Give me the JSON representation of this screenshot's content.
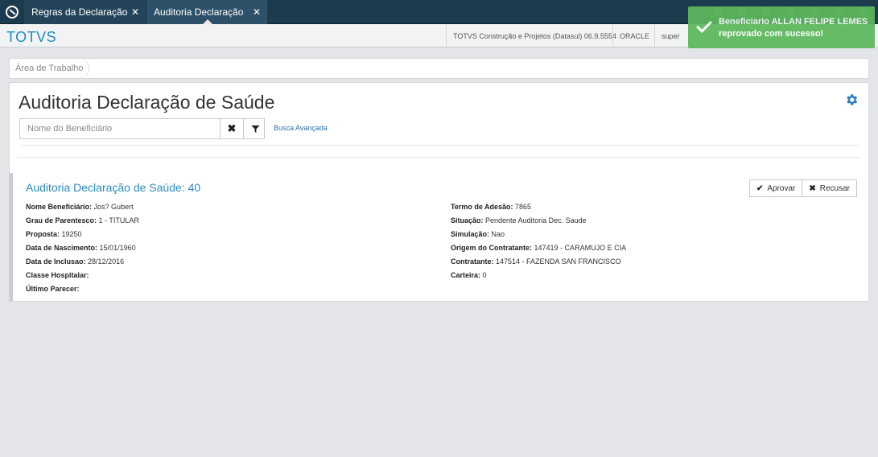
{
  "tabs": [
    {
      "label": "Regras da Declaração"
    },
    {
      "label": "Auditoria Declaração de Saúde"
    }
  ],
  "header": {
    "logo": "TOTVS",
    "company": "TOTVS Construção e Projetos (Datasul) 06.9.5554",
    "database": "ORACLE",
    "user": "super"
  },
  "breadcrumb": {
    "item": "Área de Trabalho"
  },
  "page": {
    "title": "Auditoria Declaração de Saúde",
    "search_placeholder": "Nome do Beneficiário",
    "advanced_search": "Busca Avançada"
  },
  "record": {
    "title": "Auditoria Declaração de Saúde: 40",
    "approve_label": "Aprovar",
    "reject_label": "Recusar",
    "left_fields": [
      {
        "label": "Nome Beneficiário:",
        "value": "Jos? Gubert"
      },
      {
        "label": "Grau de Parentesco:",
        "value": "1 - TITULAR"
      },
      {
        "label": "Proposta:",
        "value": "19250"
      },
      {
        "label": "Data de Nascimento:",
        "value": "15/01/1960"
      },
      {
        "label": "Data de Inclusao:",
        "value": "28/12/2016"
      },
      {
        "label": "Classe Hospitalar:",
        "value": ""
      },
      {
        "label": "Último Parecer:",
        "value": ""
      }
    ],
    "right_fields": [
      {
        "label": "Termo de Adesão:",
        "value": "7865"
      },
      {
        "label": "Situação:",
        "value": "Pendente Auditoria Dec. Saude"
      },
      {
        "label": "Simulação:",
        "value": "Nao"
      },
      {
        "label": "Origem do Contratante:",
        "value": "147419 - CARAMUJO E CIA"
      },
      {
        "label": "Contratante:",
        "value": "147514 - FAZENDA SAN FRANCISCO"
      },
      {
        "label": "Carteira:",
        "value": "0"
      }
    ]
  },
  "toast": {
    "message": "Beneficiario ALLAN FELIPE LEMES reprovado com sucesso!",
    "color": "#5cb85c"
  },
  "colors": {
    "accent": "#1e8bc3",
    "topbar": "#1d3b4f"
  }
}
